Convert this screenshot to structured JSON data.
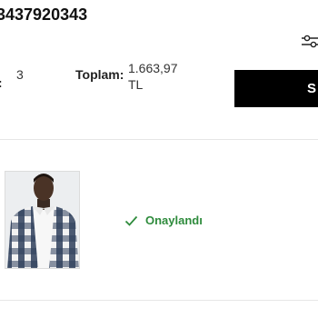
{
  "order": {
    "number": "3437920343",
    "quantity_label": "i:",
    "quantity_value": "3",
    "total_label": "Toplam:",
    "total_value": "1.663,97",
    "total_currency": "TL",
    "action_button_label": "S"
  },
  "item": {
    "status_text": "Onaylandı",
    "status_color": "#2e8b3c"
  },
  "icons": {
    "filter": "filter-sliders-icon",
    "status": "check-icon"
  }
}
